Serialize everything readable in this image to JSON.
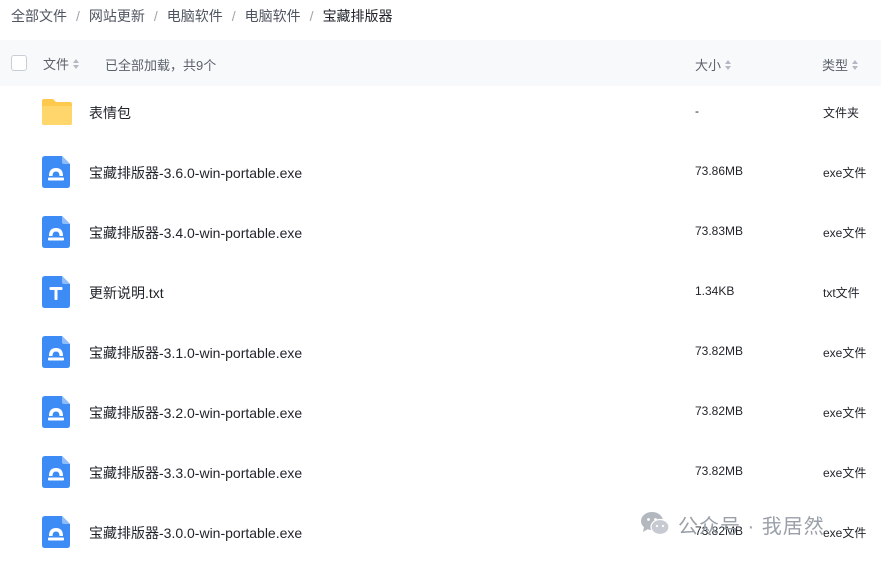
{
  "breadcrumb": {
    "items": [
      "全部文件",
      "网站更新",
      "电脑软件",
      "电脑软件"
    ],
    "current": "宝藏排版器",
    "separator": "/"
  },
  "header": {
    "file_col": "文件",
    "loaded_text": "已全部加载，共9个",
    "size_col": "大小",
    "type_col": "类型"
  },
  "files": [
    {
      "icon": "folder-icon",
      "name": "表情包",
      "size": "-",
      "type": "文件夹"
    },
    {
      "icon": "exe-file-icon",
      "name": "宝藏排版器-3.6.0-win-portable.exe",
      "size": "73.86MB",
      "type": "exe文件"
    },
    {
      "icon": "exe-file-icon",
      "name": "宝藏排版器-3.4.0-win-portable.exe",
      "size": "73.83MB",
      "type": "exe文件"
    },
    {
      "icon": "txt-file-icon",
      "name": "更新说明.txt",
      "size": "1.34KB",
      "type": "txt文件"
    },
    {
      "icon": "exe-file-icon",
      "name": "宝藏排版器-3.1.0-win-portable.exe",
      "size": "73.82MB",
      "type": "exe文件"
    },
    {
      "icon": "exe-file-icon",
      "name": "宝藏排版器-3.2.0-win-portable.exe",
      "size": "73.82MB",
      "type": "exe文件"
    },
    {
      "icon": "exe-file-icon",
      "name": "宝藏排版器-3.3.0-win-portable.exe",
      "size": "73.82MB",
      "type": "exe文件"
    },
    {
      "icon": "exe-file-icon",
      "name": "宝藏排版器-3.0.0-win-portable.exe",
      "size": "73.82MB",
      "type": "exe文件"
    }
  ],
  "watermark": {
    "text": "公众号 · 我居然",
    "icon": "wechat-icon"
  },
  "colors": {
    "accent_blue": "#3d8cf6",
    "folder_yellow": "#ffc94d",
    "header_bg": "#f8f9fb"
  }
}
